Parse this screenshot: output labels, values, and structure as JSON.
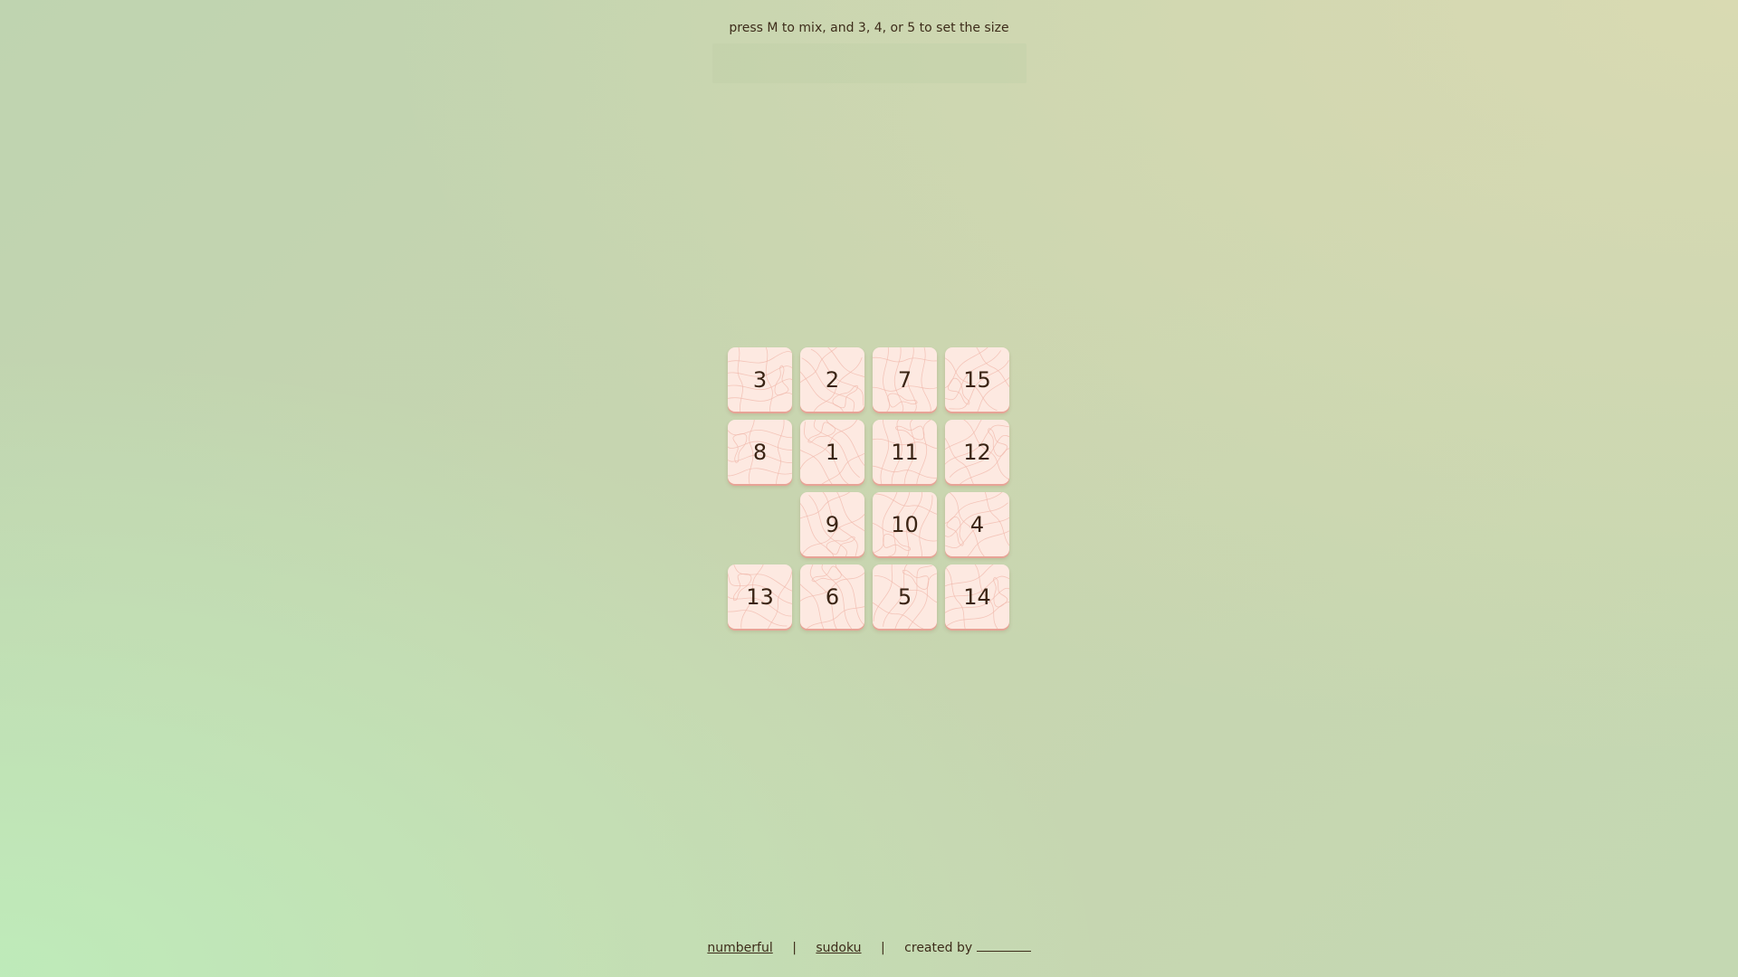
{
  "hint": "press M to mix, and 3, 4, or 5 to set the size",
  "board": {
    "size": 4,
    "tiles": [
      "3",
      "2",
      "7",
      "15",
      "8",
      "1",
      "11",
      "12",
      "",
      "9",
      "10",
      "4",
      "13",
      "6",
      "5",
      "14"
    ]
  },
  "footer": {
    "link1": "numberful",
    "sep1": "|",
    "link2": "sudoku",
    "sep2": "|",
    "created_by": "created by"
  },
  "colors": {
    "tile": "#fde9e1",
    "tile_edge": "#e7a396",
    "contour": "#f0b8ab",
    "text": "#3a2414"
  }
}
